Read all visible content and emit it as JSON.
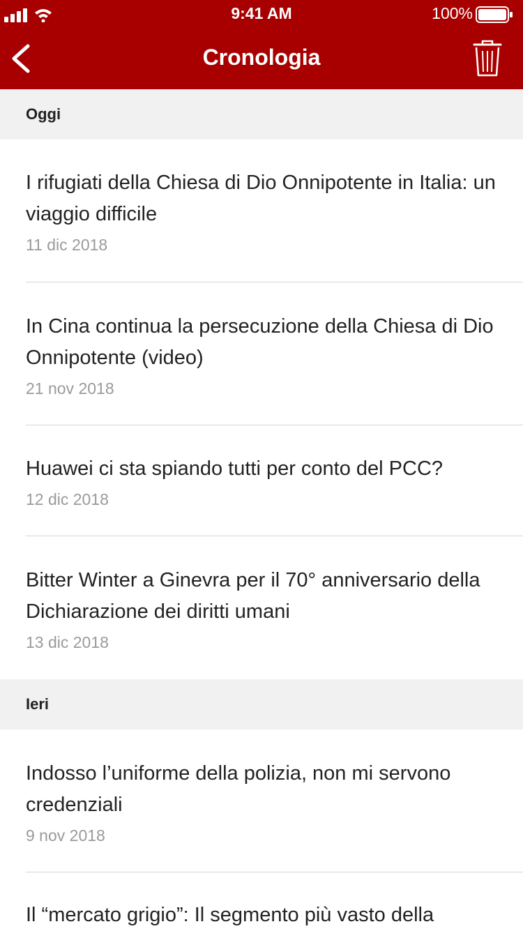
{
  "status_bar": {
    "time": "9:41 AM",
    "battery": "100%"
  },
  "nav": {
    "title": "Cronologia"
  },
  "sections": [
    {
      "label": "Oggi",
      "items": [
        {
          "title": "I rifugiati della Chiesa di Dio Onnipotente in Italia: un viaggio difficile",
          "date": "11 dic 2018"
        },
        {
          "title": "In Cina continua la persecuzione della Chiesa di Dio Onnipotente (video)",
          "date": "21 nov 2018"
        },
        {
          "title": "Huawei ci sta spiando tutti per conto del PCC?",
          "date": "12 dic 2018"
        },
        {
          "title": "Bitter Winter a Ginevra per il 70° anniversario della Dichiarazione dei diritti umani",
          "date": "13 dic 2018"
        }
      ]
    },
    {
      "label": "Ieri",
      "items": [
        {
          "title": "Indosso l’uniforme della polizia, non mi servono credenziali",
          "date": "9 nov 2018"
        },
        {
          "title": "Il “mercato grigio”: Il segmento più vasto della",
          "date": ""
        }
      ]
    }
  ],
  "colors": {
    "header": "#a80000",
    "section_bg": "#f1f1f1",
    "date": "#9a9a9a"
  }
}
